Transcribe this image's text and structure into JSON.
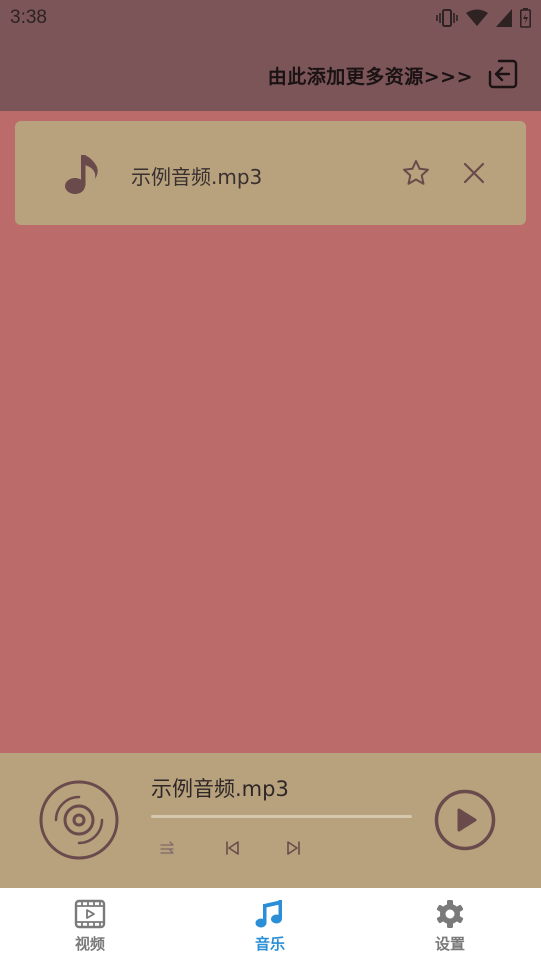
{
  "status_bar": {
    "time": "3:38"
  },
  "header": {
    "add_more_label": "由此添加更多资源>>>"
  },
  "playlist": [
    {
      "name": "示例音频.mp3"
    }
  ],
  "player": {
    "title": "示例音频.mp3",
    "progress": 0.0
  },
  "tabs": [
    {
      "label": "视频",
      "active": false
    },
    {
      "label": "音乐",
      "active": true
    },
    {
      "label": "设置",
      "active": false
    }
  ],
  "colors": {
    "header_bg": "#7b5558",
    "content_bg": "#bc6b6b",
    "card_bg": "#b7a27d",
    "icon": "#6b4a4c",
    "tab_active": "#2a8fd6",
    "tab_inactive": "#7a7a7a"
  },
  "icons": {
    "list_item": [
      "music-note-icon",
      "star-icon",
      "close-icon"
    ],
    "player": [
      "disc-icon",
      "shuffle-icon",
      "previous-icon",
      "next-icon",
      "play-icon"
    ],
    "tabs": [
      "video-icon",
      "music-icon",
      "gear-icon"
    ],
    "header": [
      "import-icon"
    ]
  }
}
